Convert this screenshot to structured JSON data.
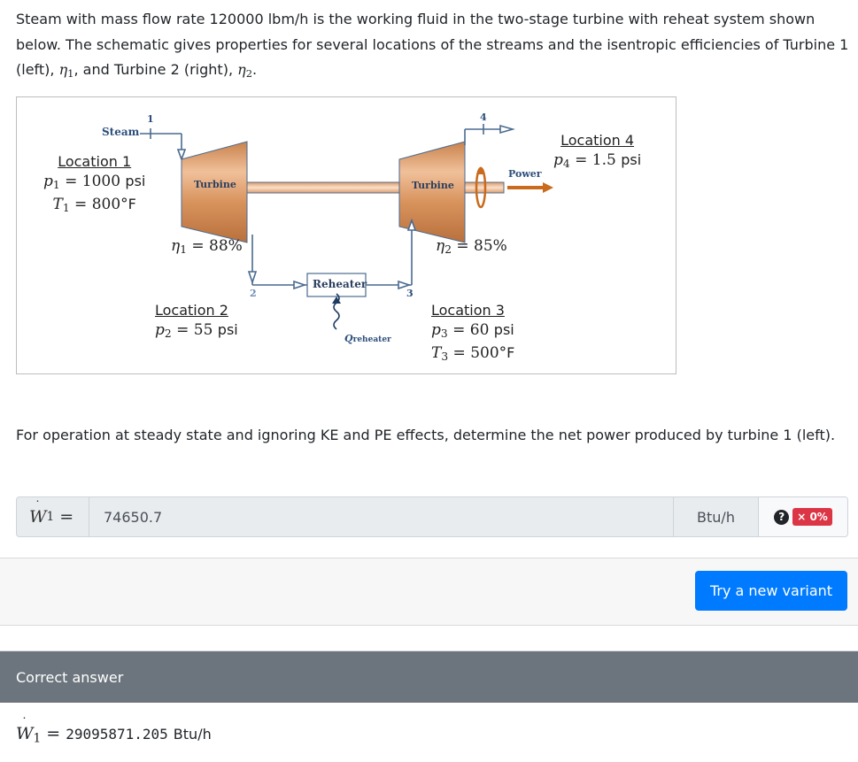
{
  "question": {
    "intro_part1": "Steam with mass flow rate 120000 lbm/h is the working fluid in the two-stage turbine with reheat system shown below. The schematic gives properties for several locations of the streams and the isentropic efficiencies of Turbine 1 (left), ",
    "eta1_symbol": "η",
    "eta1_sub": "1",
    "intro_part2": ", and Turbine 2 (right), ",
    "eta2_symbol": "η",
    "eta2_sub": "2",
    "intro_part3": ".",
    "prompt": "For operation at steady state and ignoring KE and PE effects, determine the net power produced by turbine 1 (left)."
  },
  "schematic": {
    "steam_label": "Steam",
    "point_labels": [
      "1",
      "2",
      "3",
      "4"
    ],
    "turbine1_label": "Turbine",
    "turbine2_label": "Turbine",
    "power_label": "Power",
    "reheater_label": "Reheater",
    "q_label": "Q",
    "q_sub": "reheater",
    "location1": {
      "title": "Location 1",
      "p_var": "p",
      "p_sub": "1",
      "p_value": "1000",
      "p_unit": "psi",
      "t_var": "T",
      "t_sub": "1",
      "t_value": "800°",
      "t_unit": "F"
    },
    "location2": {
      "title": "Location 2",
      "p_var": "p",
      "p_sub": "2",
      "p_value": "55",
      "p_unit": "psi"
    },
    "location3": {
      "title": "Location 3",
      "p_var": "p",
      "p_sub": "3",
      "p_value": "60",
      "p_unit": "psi",
      "t_var": "T",
      "t_sub": "3",
      "t_value": "500°",
      "t_unit": "F"
    },
    "location4": {
      "title": "Location 4",
      "p_var": "p",
      "p_sub": "4",
      "p_value": "1.5",
      "p_unit": "psi"
    },
    "eta1": {
      "var": "η",
      "sub": "1",
      "value": "88%"
    },
    "eta2": {
      "var": "η",
      "sub": "2",
      "value": "85%"
    },
    "colors": {
      "turbine": "#d18a55",
      "line": "#4a6a8f",
      "power_arrow": "#c96a1c"
    }
  },
  "answer_input": {
    "lhs_var": "W",
    "lhs_sub": "1",
    "equals": "=",
    "value": "74650.7",
    "unit": "Btu/h",
    "help_icon": "question-circle-icon",
    "status_badge": "0%",
    "status_icon": "×"
  },
  "actions": {
    "new_variant_label": "Try a new variant"
  },
  "correct_answer": {
    "header": "Correct answer",
    "lhs_var": "W",
    "lhs_sub": "1",
    "equals": "=",
    "value": "29095871.205",
    "unit": "Btu/h"
  },
  "colors": {
    "primary": "#007bff",
    "danger": "#dc3545",
    "header_gray": "#6c757d",
    "input_bg": "#e9ecef"
  }
}
